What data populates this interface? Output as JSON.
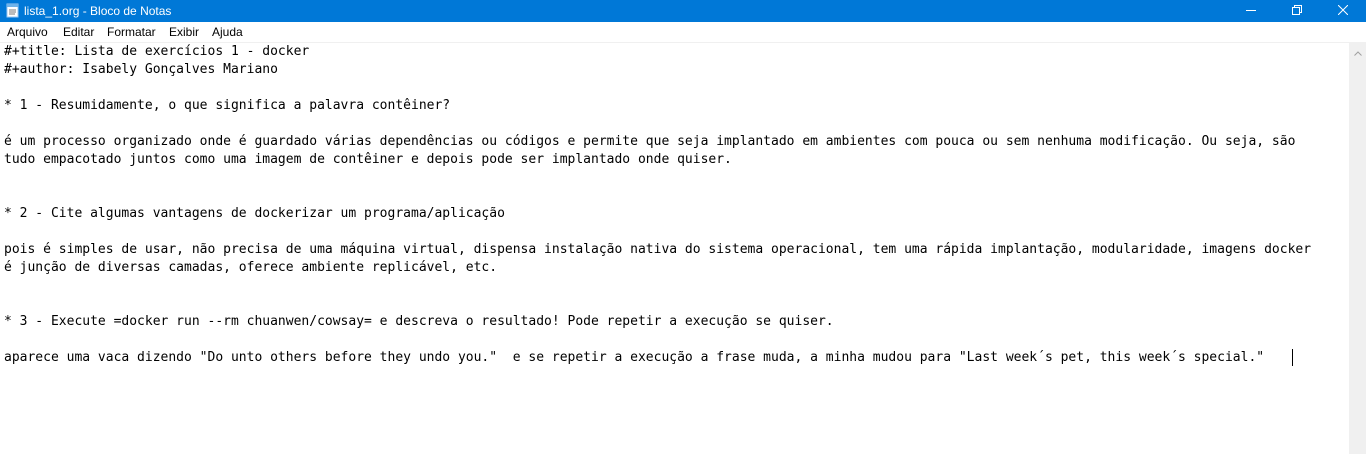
{
  "window": {
    "title": "lista_1.org - Bloco de Notas",
    "title_bar_color": "#0078d7"
  },
  "menu": {
    "items": [
      "Arquivo",
      "Editar",
      "Formatar",
      "Exibir",
      "Ajuda"
    ]
  },
  "editor": {
    "lines": [
      "#+title: Lista de exercícios 1 - docker",
      "#+author: Isabely Gonçalves Mariano",
      "* 1 - Resumidamente, o que significa a palavra contêiner?",
      "é um processo organizado onde é guardado várias dependências ou códigos e permite que seja implantado em ambientes com pouca ou sem nenhuma modificação. Ou seja, são",
      "tudo empacotado juntos como uma imagem de contêiner e depois pode ser implantado onde quiser.",
      "* 2 - Cite algumas vantagens de dockerizar um programa/aplicação",
      "pois é simples de usar, não precisa de uma máquina virtual, dispensa instalação nativa do sistema operacional, tem uma rápida implantação, modularidade, imagens docker",
      "é junção de diversas camadas, oferece ambiente replicável, etc.",
      "* 3 - Execute =docker run --rm chuanwen/cowsay= e descreva o resultado! Pode repetir a execução se quiser.",
      "aparece uma vaca dizendo \"Do unto others before they undo you.\"  e se repetir a execução a frase muda, a minha mudou para \"Last week´s pet, this week´s special.\""
    ]
  },
  "icons": {
    "app": "notepad-icon",
    "minimize": "minimize-icon",
    "maximize": "restore-icon",
    "close": "close-icon",
    "scroll_up": "scroll-up-arrow-icon"
  }
}
